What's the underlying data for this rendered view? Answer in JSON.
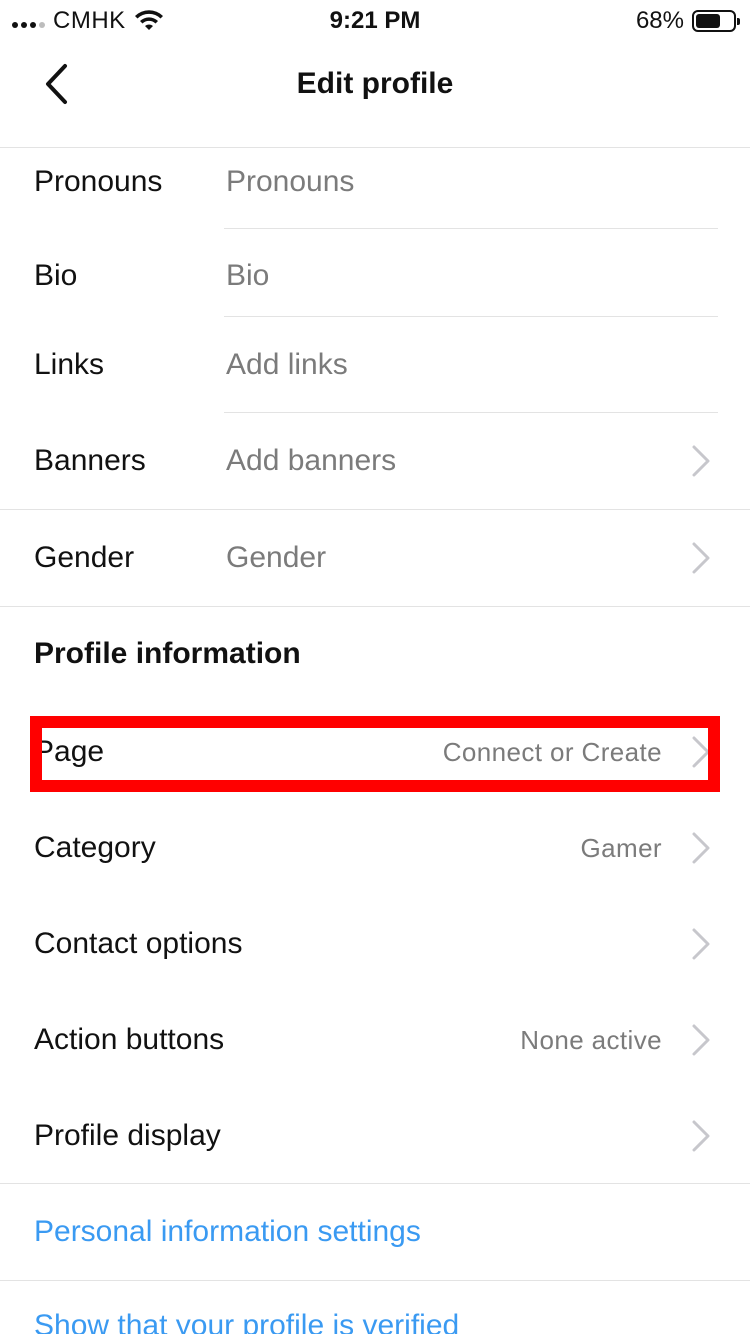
{
  "status_bar": {
    "carrier": "CMHK",
    "time": "9:21 PM",
    "battery_percent": "68%",
    "battery_level": 0.68
  },
  "nav": {
    "title": "Edit profile",
    "back_icon": "chevron-left-icon"
  },
  "fields": [
    {
      "label": "Pronouns",
      "placeholder": "Pronouns"
    },
    {
      "label": "Bio",
      "placeholder": "Bio"
    },
    {
      "label": "Links",
      "placeholder": "Add links"
    },
    {
      "label": "Banners",
      "placeholder": "Add banners"
    },
    {
      "label": "Gender",
      "placeholder": "Gender"
    }
  ],
  "profile_information": {
    "title": "Profile information",
    "items": [
      {
        "label": "Page",
        "value": "Connect or Create"
      },
      {
        "label": "Category",
        "value": "Gamer"
      },
      {
        "label": "Contact options",
        "value": ""
      },
      {
        "label": "Action buttons",
        "value": "None active"
      },
      {
        "label": "Profile display",
        "value": ""
      }
    ]
  },
  "links": {
    "personal_info": "Personal information settings",
    "verified": "Show that your profile is verified"
  },
  "colors": {
    "link": "#3a9af2",
    "highlight": "#ff0000",
    "secondary_text": "#7b7b7b",
    "divider": "#e3e3e3"
  }
}
